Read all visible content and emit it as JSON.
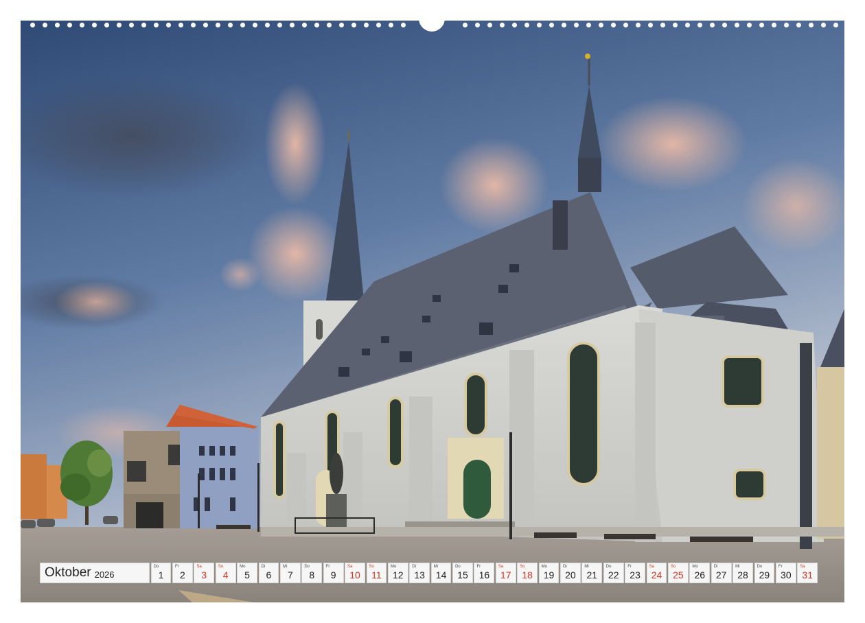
{
  "calendar": {
    "month": "Oktober",
    "year": "2026",
    "days": [
      {
        "abbr": "Do",
        "num": "1",
        "weekend": false
      },
      {
        "abbr": "Fr",
        "num": "2",
        "weekend": false
      },
      {
        "abbr": "Sa",
        "num": "3",
        "weekend": true
      },
      {
        "abbr": "So",
        "num": "4",
        "weekend": true
      },
      {
        "abbr": "Mo",
        "num": "5",
        "weekend": false
      },
      {
        "abbr": "Di",
        "num": "6",
        "weekend": false
      },
      {
        "abbr": "Mi",
        "num": "7",
        "weekend": false
      },
      {
        "abbr": "Do",
        "num": "8",
        "weekend": false
      },
      {
        "abbr": "Fr",
        "num": "9",
        "weekend": false
      },
      {
        "abbr": "Sa",
        "num": "10",
        "weekend": true
      },
      {
        "abbr": "So",
        "num": "11",
        "weekend": true
      },
      {
        "abbr": "Mo",
        "num": "12",
        "weekend": false
      },
      {
        "abbr": "Di",
        "num": "13",
        "weekend": false
      },
      {
        "abbr": "Mi",
        "num": "14",
        "weekend": false
      },
      {
        "abbr": "Do",
        "num": "15",
        "weekend": false
      },
      {
        "abbr": "Fr",
        "num": "16",
        "weekend": false
      },
      {
        "abbr": "Sa",
        "num": "17",
        "weekend": true
      },
      {
        "abbr": "So",
        "num": "18",
        "weekend": true
      },
      {
        "abbr": "Mo",
        "num": "19",
        "weekend": false
      },
      {
        "abbr": "Di",
        "num": "20",
        "weekend": false
      },
      {
        "abbr": "Mi",
        "num": "21",
        "weekend": false
      },
      {
        "abbr": "Do",
        "num": "22",
        "weekend": false
      },
      {
        "abbr": "Fr",
        "num": "23",
        "weekend": false
      },
      {
        "abbr": "Sa",
        "num": "24",
        "weekend": true
      },
      {
        "abbr": "So",
        "num": "25",
        "weekend": true
      },
      {
        "abbr": "Mo",
        "num": "26",
        "weekend": false
      },
      {
        "abbr": "Di",
        "num": "27",
        "weekend": false
      },
      {
        "abbr": "Mi",
        "num": "28",
        "weekend": false
      },
      {
        "abbr": "Do",
        "num": "29",
        "weekend": false
      },
      {
        "abbr": "Fr",
        "num": "30",
        "weekend": false
      },
      {
        "abbr": "Sa",
        "num": "31",
        "weekend": true
      }
    ]
  },
  "colors": {
    "weekend": "#d8341e",
    "weekday": "#222222",
    "cell_background": "#f6f6f6"
  },
  "photo": {
    "subject_icon": "church-photo"
  }
}
